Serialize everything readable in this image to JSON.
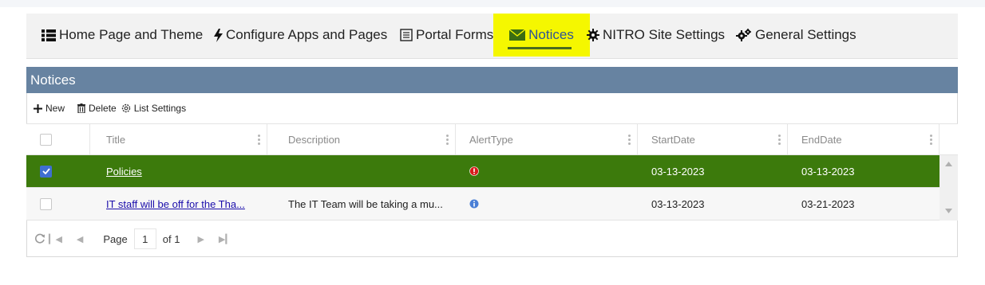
{
  "nav": {
    "items": [
      {
        "label": "Home Page and Theme",
        "icon": "list-icon"
      },
      {
        "label": "Configure Apps and Pages",
        "icon": "bolt-icon"
      },
      {
        "label": "Portal Forms",
        "icon": "form-icon"
      },
      {
        "label": "Notices",
        "icon": "envelope-icon"
      },
      {
        "label": "NITRO Site Settings",
        "icon": "gear-icon"
      },
      {
        "label": "General Settings",
        "icon": "gears-icon"
      }
    ],
    "active_index": 3,
    "highlight_color": "#f5f700"
  },
  "panel": {
    "title": "Notices",
    "header_color": "#6783a1"
  },
  "toolbar": {
    "new_label": "New",
    "delete_label": "Delete",
    "settings_label": "List Settings"
  },
  "grid": {
    "columns": [
      "Title",
      "Description",
      "AlertType",
      "StartDate",
      "EndDate"
    ],
    "rows": [
      {
        "title": "Policies",
        "description": "",
        "alert": "error",
        "start": "03-13-2023",
        "end": "03-13-2023",
        "selected": true
      },
      {
        "title": "IT staff will be off for the Tha...",
        "description": "The IT Team will be taking a mu...",
        "alert": "info",
        "start": "03-13-2023",
        "end": "03-21-2023",
        "selected": false
      }
    ],
    "selected_color": "#3c7a0c"
  },
  "pager": {
    "page_label": "Page",
    "page_value": "1",
    "of_label": "of 1"
  }
}
